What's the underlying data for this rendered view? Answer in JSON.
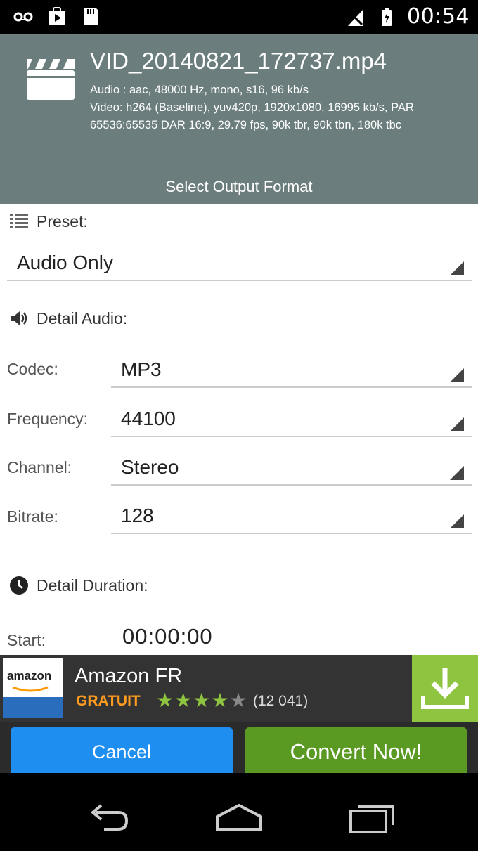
{
  "status_bar": {
    "time": "00:54",
    "icons": [
      "voicemail-icon",
      "play-store-icon",
      "sd-card-icon",
      "signal-icon",
      "battery-icon"
    ]
  },
  "header": {
    "filename": "VID_20140821_172737.mp4",
    "audio_info": "Audio : aac, 48000 Hz, mono, s16, 96 kb/s",
    "video_info": "Video: h264 (Baseline), yuv420p, 1920x1080, 16995 kb/s, PAR 65536:65535 DAR 16:9, 29.79 fps, 90k tbr, 90k tbn, 180k tbc",
    "icon": "clapperboard-icon"
  },
  "format_bar": {
    "label": "Select Output Format"
  },
  "preset": {
    "title": "Preset:",
    "icon": "list-icon",
    "value": "Audio Only"
  },
  "detail_audio": {
    "title": "Detail Audio:",
    "icon": "speaker-icon",
    "rows": [
      {
        "label": "Codec:",
        "value": "MP3"
      },
      {
        "label": "Frequency:",
        "value": "44100"
      },
      {
        "label": "Channel:",
        "value": "Stereo"
      },
      {
        "label": "Bitrate:",
        "value": "128"
      }
    ]
  },
  "detail_duration": {
    "title": "Detail Duration:",
    "icon": "clock-icon",
    "start_label": "Start:",
    "start_value": "00:00:00"
  },
  "ad": {
    "logo_text": "amazon",
    "name": "Amazon FR",
    "price": "GRATUIT",
    "rating": 4,
    "rating_max": 5,
    "review_count": "(12 041)",
    "icon": "download-icon",
    "accent": "#8ec43f",
    "price_color": "#ff9b1e"
  },
  "buttons": {
    "cancel": "Cancel",
    "convert": "Convert Now!",
    "cancel_color": "#1e8ff0",
    "convert_color": "#5a9a23"
  },
  "nav": {
    "icons": [
      "back-icon",
      "home-icon",
      "recents-icon"
    ]
  },
  "colors": {
    "header_bg": "#6b7e7d"
  }
}
